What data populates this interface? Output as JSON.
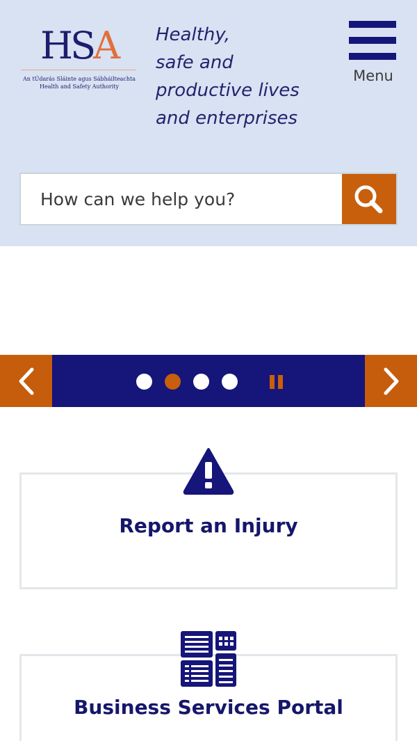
{
  "brand": {
    "logo_initials": {
      "h": "H",
      "s": "S",
      "a": "A"
    },
    "logo_subtitle_irish": "An tÚdarás Sláinte agus Sábháilteachta",
    "logo_subtitle_english": "Health and Safety Authority",
    "tagline_lines": [
      "Healthy,",
      "safe and",
      "productive lives",
      "and enterprises"
    ]
  },
  "menu": {
    "label": "Menu",
    "icon": "hamburger-icon"
  },
  "search": {
    "placeholder": "How can we help you?",
    "value": "",
    "icon": "search-icon"
  },
  "carousel": {
    "prev_icon": "chevron-left-icon",
    "next_icon": "chevron-right-icon",
    "slide_count": 4,
    "active_slide": 2,
    "pause_icon": "pause-icon"
  },
  "cards": [
    {
      "title": "Report an Injury",
      "icon": "warning-triangle-icon"
    },
    {
      "title": "Business Services Portal",
      "icon": "portal-dashboard-icon"
    }
  ],
  "colors": {
    "header_bg": "#d8e2f2",
    "navy": "#15157a",
    "accent_orange": "#c85f0c",
    "logo_orange": "#e26f3c"
  }
}
